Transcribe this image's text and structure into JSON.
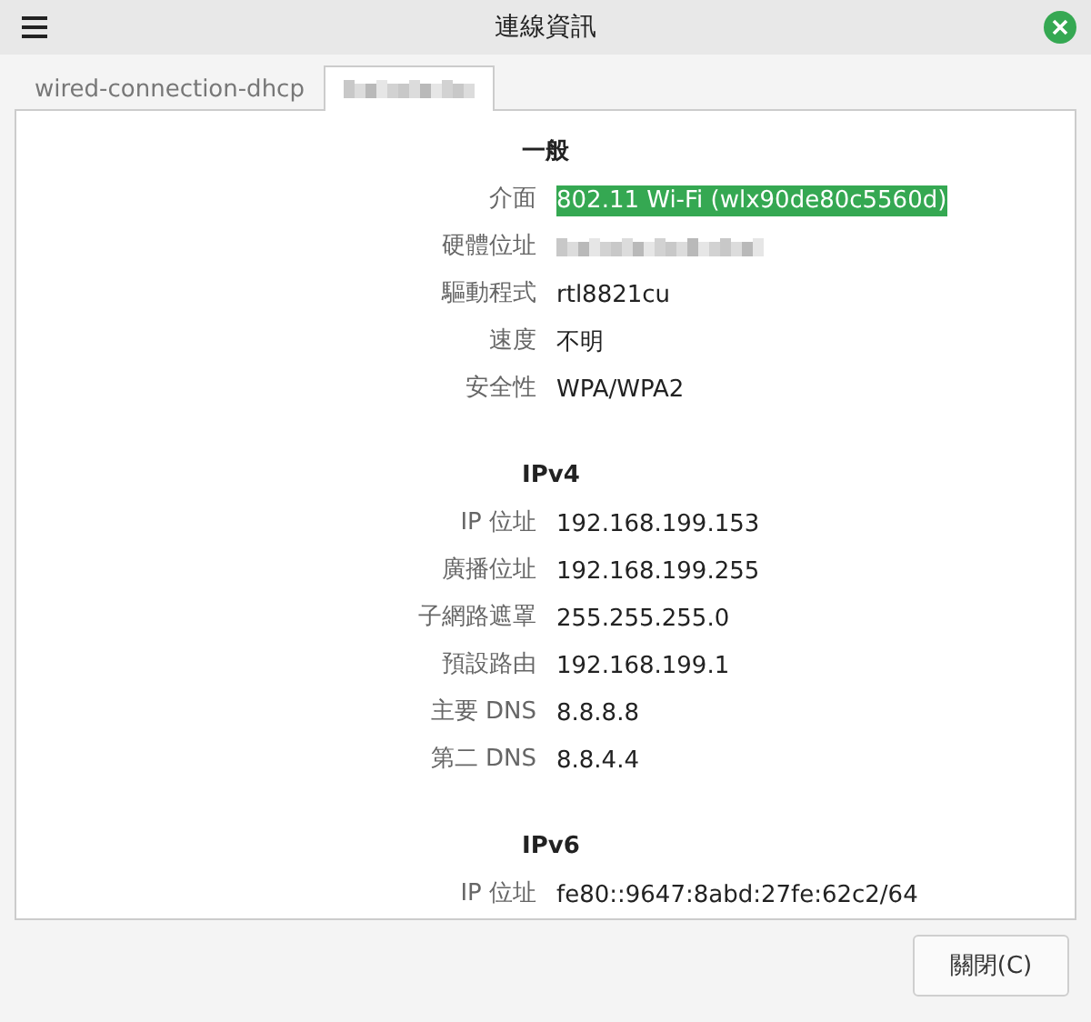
{
  "window": {
    "title": "連線資訊"
  },
  "tabs": [
    {
      "label": "wired-connection-dhcp",
      "kind": "text",
      "selected": false
    },
    {
      "kind": "blurred",
      "selected": true
    }
  ],
  "sections": [
    {
      "title": "一般",
      "rows": [
        {
          "label": "介面",
          "value": "802.11 Wi-Fi (wlx90de80c5560d)",
          "kind": "text",
          "selected": true
        },
        {
          "label": "硬體位址",
          "kind": "blurred",
          "selected": false
        },
        {
          "label": "驅動程式",
          "value": "rtl8821cu",
          "kind": "text",
          "selected": false
        },
        {
          "label": "速度",
          "value": "不明",
          "kind": "text",
          "selected": false
        },
        {
          "label": "安全性",
          "value": "WPA/WPA2",
          "kind": "text",
          "selected": false
        }
      ]
    },
    {
      "title": "IPv4",
      "rows": [
        {
          "label": "IP 位址",
          "value": "192.168.199.153",
          "kind": "text",
          "selected": false
        },
        {
          "label": "廣播位址",
          "value": "192.168.199.255",
          "kind": "text",
          "selected": false
        },
        {
          "label": "子網路遮罩",
          "value": "255.255.255.0",
          "kind": "text",
          "selected": false
        },
        {
          "label": "預設路由",
          "value": "192.168.199.1",
          "kind": "text",
          "selected": false
        },
        {
          "label": "主要 DNS",
          "value": "8.8.8.8",
          "kind": "text",
          "selected": false
        },
        {
          "label": "第二 DNS",
          "value": "8.8.4.4",
          "kind": "text",
          "selected": false
        }
      ]
    },
    {
      "title": "IPv6",
      "rows": [
        {
          "label": "IP 位址",
          "value": "fe80::9647:8abd:27fe:62c2/64",
          "kind": "text",
          "selected": false
        }
      ]
    }
  ],
  "buttons": [
    {
      "label": "關閉(C)"
    }
  ]
}
